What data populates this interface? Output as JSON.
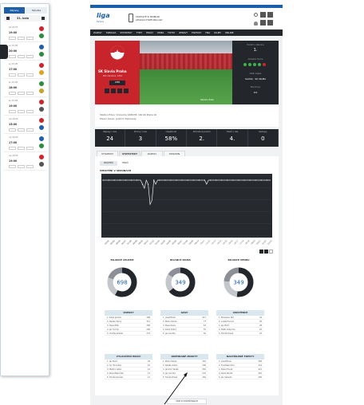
{
  "sidebar": {
    "tabs": [
      "Zápasy",
      "Tabulka"
    ],
    "round_label": "31. kolo",
    "matches": [
      {
        "date": "po 24.05",
        "time": "19:00",
        "home": "#d0232a",
        "away": "#2a8f3c",
        "score": ""
      },
      {
        "date": "so 15.05",
        "time": "20:00",
        "home": "#1e5fb3",
        "away": "#2a8f3c",
        "score": ""
      },
      {
        "date": "so 15.05",
        "time": "17:00",
        "home": "#d0232a",
        "away": "#e0a020",
        "score": ""
      },
      {
        "date": "so 15.05",
        "time": "18:00",
        "home": "#2a8f3c",
        "away": "#c9a227",
        "score": ""
      },
      {
        "date": "so 15.05",
        "time": "19:00",
        "home": "#d0232a",
        "away": "#555555",
        "score": ""
      },
      {
        "date": "ne 16.05",
        "time": "15:00",
        "home": "#d0232a",
        "away": "#1e5fb3",
        "score": ""
      },
      {
        "date": "ne 16.05",
        "time": "17:00",
        "home": "#1e5fb3",
        "away": "#2a8f3c",
        "score": ""
      },
      {
        "date": "ne 16.05",
        "time": "19:00",
        "home": "#d0232a",
        "away": "#555555",
        "score": ""
      }
    ]
  },
  "header": {
    "logo": "liga",
    "logo_sub": "fortuna",
    "promo_line1": "STAHUJTE SI MOBILNÍ",
    "promo_line2": "APLIKACI FORTUNA:LIGY",
    "nav": [
      "ZÁPASY",
      "TABULKA",
      "STATISTIKY",
      "TÝMY",
      "HRÁČI",
      "VIDEA",
      "FOTKY",
      "ZPRÁVY",
      "FANTASY",
      "HRA",
      "KLUBY",
      "ONLINE"
    ]
  },
  "club": {
    "name": "SK Slavia Praha",
    "founded": "Rok založení: 1892",
    "button": "WEB",
    "photo_caption": "Stadion Eden",
    "side": [
      {
        "label": "Pořadí v tabulce",
        "value": "1."
      },
      {
        "label": "Aktuální forma",
        "value": ""
      },
      {
        "label": "Další zápas",
        "value": "SLAVIA : SK SIGMA"
      },
      {
        "label": "Před hrou",
        "value": "0:0"
      }
    ],
    "info_line1": "Stadion Eden, Vršovická 1489/78, 100 00 Praha 10",
    "info_line2": "Hlavní trenér: Jindřich Trpišovský"
  },
  "stats": [
    {
      "value": "24",
      "label": "Zápasy v lize"
    },
    {
      "value": "3",
      "label": "Prohry v lize"
    },
    {
      "value": "58%",
      "label": "Úspěšnost"
    },
    {
      "value": "2.",
      "label": "Průměrné pořadí"
    },
    {
      "value": "4.",
      "label": "Titulů v lize"
    },
    {
      "value": "0",
      "label": "Sestupy"
    }
  ],
  "tabs": [
    "VÝSLEDKY",
    "STATISTIKY",
    "ZÁPASY",
    "STADION"
  ],
  "active_tab": 1,
  "subtabs": [
    "NEJLEPŠÍ",
    "HRÁČI"
  ],
  "chart_data": {
    "type": "line",
    "title": "UMÍSTĚNÍ V SEZONÁCH",
    "x": [
      "93/94",
      "94/95",
      "95/96",
      "96/97",
      "97/98",
      "98/99",
      "99/00",
      "00/01",
      "01/02",
      "02/03",
      "03/04",
      "04/05",
      "05/06",
      "06/07",
      "07/08",
      "08/09",
      "09/10",
      "10/11",
      "11/12",
      "12/13",
      "13/14",
      "14/15",
      "15/16",
      "16/17",
      "17/18",
      "18/19",
      "19/20",
      "20/21",
      "21/22",
      "22/23"
    ],
    "series": [
      {
        "name": "",
        "values": [
          1,
          1,
          1,
          1,
          1,
          1,
          1,
          1,
          1,
          1,
          1,
          1,
          1,
          1,
          1,
          1,
          1,
          1,
          1,
          1,
          1,
          2,
          3,
          1,
          2,
          7,
          6,
          1,
          2,
          1,
          1,
          1,
          1,
          1,
          1,
          1,
          1,
          1,
          1,
          1,
          1,
          1,
          1,
          1,
          1,
          1,
          1,
          1,
          1,
          1,
          1,
          1,
          1,
          1,
          1,
          2,
          1,
          1,
          1,
          1,
          1,
          1,
          1,
          1,
          1,
          1,
          1,
          1,
          1,
          1,
          1,
          1,
          1,
          1,
          1,
          1,
          1,
          1,
          1,
          1,
          1,
          1,
          1,
          1,
          1,
          1,
          1,
          1,
          1,
          1
        ]
      }
    ],
    "ylim": [
      1,
      16
    ]
  },
  "donuts": [
    {
      "title": "BILANCE CELKEM",
      "value": "698",
      "fractions": [
        0.58,
        0.22,
        0.2
      ]
    },
    {
      "title": "BILANCE DOMA",
      "value": "349",
      "fractions": [
        0.64,
        0.2,
        0.16
      ]
    },
    {
      "title": "BILANCE VENKU",
      "value": "349",
      "fractions": [
        0.52,
        0.24,
        0.24
      ]
    }
  ],
  "tables": [
    {
      "title": "ZÁPASY",
      "rows": [
        [
          "1. Karel Jarolím",
          "398"
        ],
        [
          "2. Radek Černý",
          "311"
        ],
        [
          "3. Pavel Pilík",
          "308"
        ],
        [
          "4. Jan Suchý",
          "290"
        ],
        [
          "5. Ondřej Kúdela",
          "272"
        ]
      ]
    },
    {
      "title": "GÓLY",
      "rows": [
        [
          "1. Josef Bican",
          "417"
        ],
        [
          "2. Milan Škoda",
          "77"
        ],
        [
          "3. Pavel Kuka",
          "63"
        ],
        [
          "4. Karel Dobrý",
          "55"
        ],
        [
          "5. Jan Kuchta",
          "50"
        ]
      ]
    },
    {
      "title": "ASISTENCE",
      "rows": [
        [
          "1. Stanislav Tecl",
          "34"
        ],
        [
          "2. Lukáš Provod",
          "30"
        ],
        [
          "3. Jan Bořil",
          "28"
        ],
        [
          "4. Peter Olayinka",
          "25"
        ],
        [
          "5. Tomáš Holeš",
          "22"
        ]
      ]
    },
    {
      "title": "VYLOUČENÍ HRÁČI",
      "rows": [
        [
          "1. Jan Bořil",
          "18"
        ],
        [
          "2. Ivo Trnovský",
          "16"
        ],
        [
          "3. Martin Latka",
          "14"
        ],
        [
          "4. Pavel Řezníček",
          "13"
        ],
        [
          "5. Tomáš Souček",
          "12"
        ]
      ]
    },
    {
      "title": "ODEHRANÉ MINUTY",
      "rows": [
        [
          "1. Milan Škoda",
          "310"
        ],
        [
          "2. Radek Adam",
          "290"
        ],
        [
          "3. Jaromír Vaňák",
          "281"
        ],
        [
          "4. Jan Vondra",
          "270"
        ],
        [
          "5. Tomáš Holeš",
          "262"
        ]
      ]
    },
    {
      "title": "NASTŘÍLENÉ TRESTY",
      "rows": [
        [
          "1. Josef Bican",
          "483"
        ],
        [
          "2. František Kloz",
          "431"
        ],
        [
          "3. Pavel Horák",
          "421"
        ],
        [
          "4. Karel Novák",
          "410"
        ],
        [
          "5. Jan Valenta",
          "405"
        ]
      ]
    }
  ],
  "footer_link": "VÍCE O STATISTIKÁCH",
  "colors": {
    "accent": "#1d5fa8",
    "dark": "#23262b",
    "red": "#d0232a",
    "green": "#3bb34a"
  }
}
